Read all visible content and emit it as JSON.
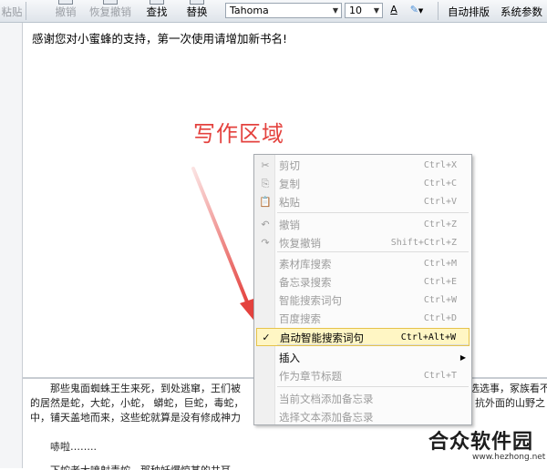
{
  "toolbar": {
    "paste": "粘贴",
    "undo": "撤销",
    "redo": "恢复撤销",
    "find": "查找",
    "replace": "替换",
    "font": "Tahoma",
    "font_size": "10",
    "font_color_glyph": "A",
    "auto_layout": "自动排版",
    "settings": "系统参数"
  },
  "editor": {
    "intro": "感谢您对小蜜蜂的支持，第一次使用请增加新书名!",
    "lower_lines": [
      "那些鬼面蜘蛛王生来死，到处逃窜，王们被",
      "的居然是蛇，大蛇，小蛇，    蟒蛇，巨蛇，毒蛇，",
      "中，铺天盖地而来，这些蛇就算是没有修成神力",
      "哧啦……..",
      "下蛇老大喷射毒蛇，那种妖爆惊某的共耳"
    ],
    "lower_right": [
      "选选事，冢族看不",
      "抗外面的山野之"
    ]
  },
  "annotation": {
    "text": "写作区域",
    "color": "#e4423e"
  },
  "menu": {
    "items": [
      {
        "icon": "✂",
        "icon_name": "scissors-icon",
        "label": "剪切",
        "shortcut": "Ctrl+X",
        "disabled": true
      },
      {
        "icon": "⎘",
        "icon_name": "copy-icon",
        "label": "复制",
        "shortcut": "Ctrl+C",
        "disabled": true
      },
      {
        "icon": "📋",
        "icon_name": "clipboard-icon",
        "label": "粘贴",
        "shortcut": "Ctrl+V",
        "disabled": true
      },
      {
        "icon": "↶",
        "icon_name": "undo-icon",
        "label": "撤销",
        "shortcut": "Ctrl+Z",
        "disabled": true
      },
      {
        "icon": "↷",
        "icon_name": "redo-icon",
        "label": "恢复撤销",
        "shortcut": "Shift+Ctrl+Z",
        "disabled": true
      },
      {
        "icon": "",
        "icon_name": "",
        "label": "素材库搜索",
        "shortcut": "Ctrl+M",
        "disabled": true
      },
      {
        "icon": "",
        "icon_name": "",
        "label": "备忘录搜索",
        "shortcut": "Ctrl+E",
        "disabled": true
      },
      {
        "icon": "",
        "icon_name": "",
        "label": "智能搜索词句",
        "shortcut": "Ctrl+W",
        "disabled": true
      },
      {
        "icon": "",
        "icon_name": "",
        "label": "百度搜索",
        "shortcut": "Ctrl+D",
        "disabled": true
      },
      {
        "icon": "✓",
        "icon_name": "checkmark-icon",
        "label": "启动智能搜索词句",
        "shortcut": "Ctrl+Alt+W",
        "disabled": false,
        "highlight": true
      },
      {
        "icon": "",
        "icon_name": "",
        "label": "插入",
        "shortcut": "",
        "disabled": false,
        "submenu": true
      },
      {
        "icon": "",
        "icon_name": "",
        "label": "作为章节标题",
        "shortcut": "Ctrl+T",
        "disabled": true
      },
      {
        "icon": "",
        "icon_name": "",
        "label": "当前文档添加备忘录",
        "shortcut": "",
        "disabled": true
      },
      {
        "icon": "",
        "icon_name": "",
        "label": "选择文本添加备忘录",
        "shortcut": "",
        "disabled": true
      }
    ]
  },
  "watermark": {
    "title": "合众软件园",
    "url": "www.hezhong.net"
  }
}
